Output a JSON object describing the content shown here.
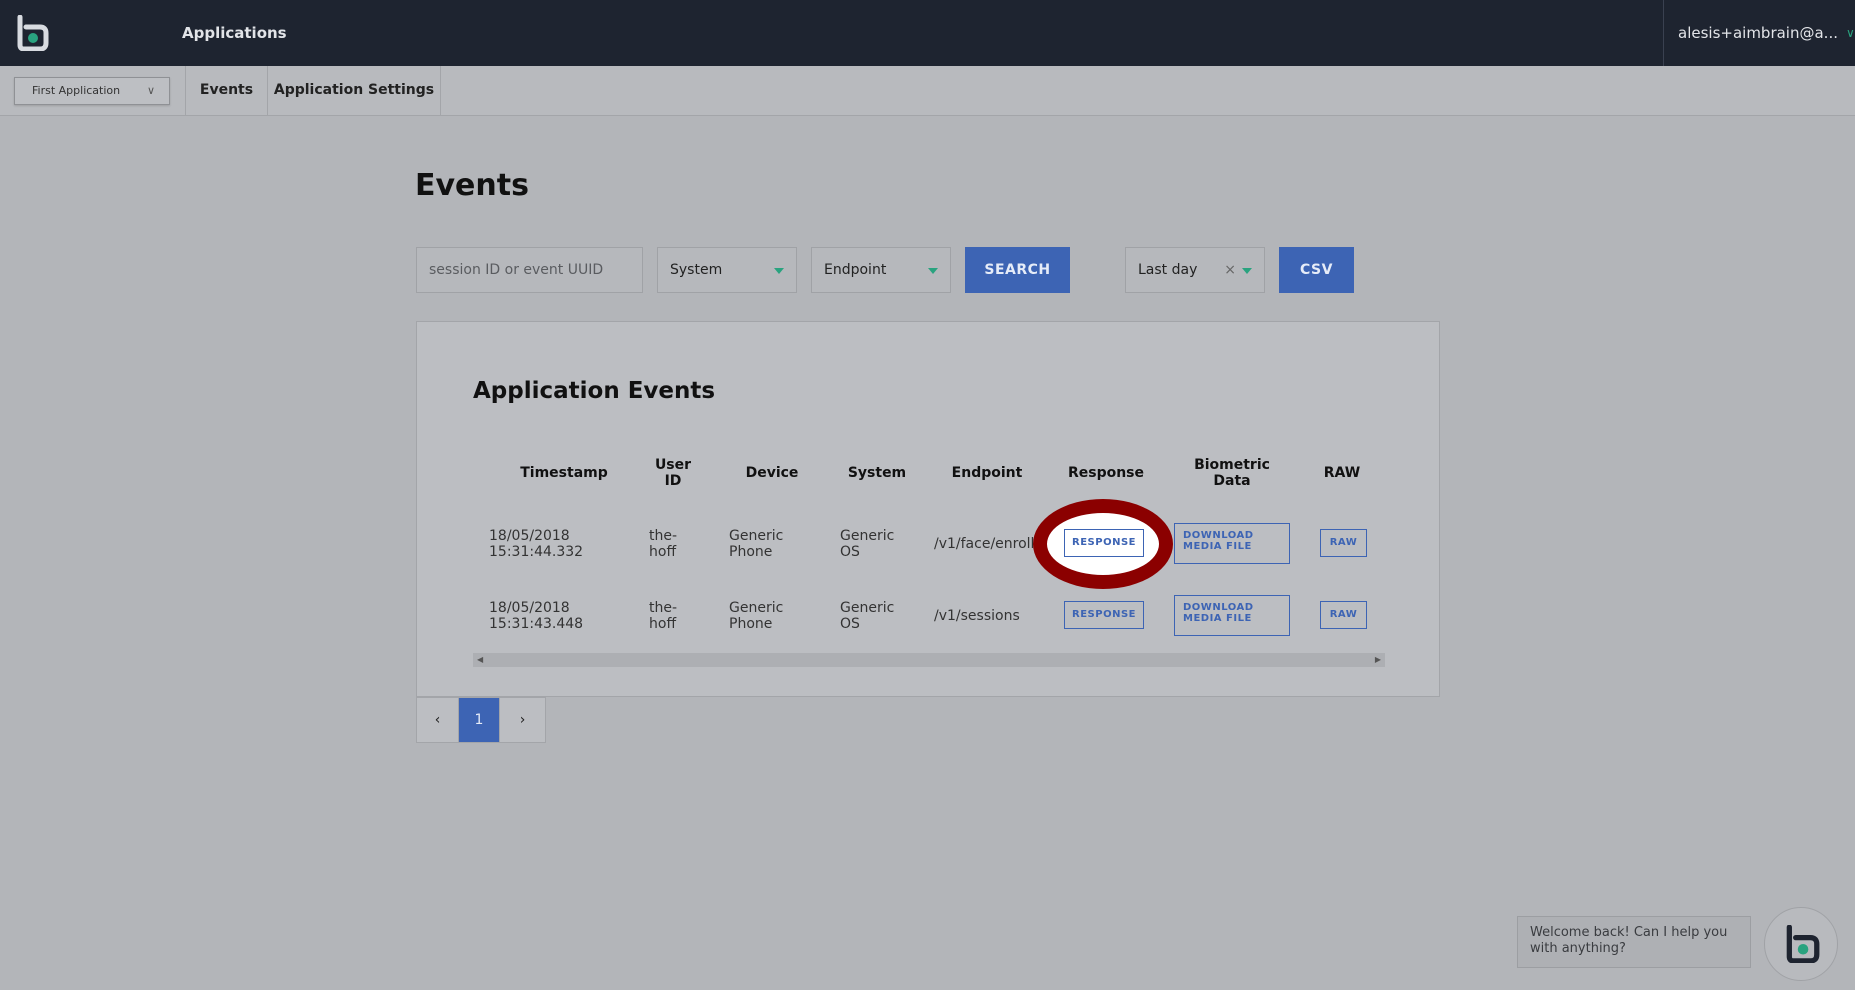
{
  "topbar": {
    "nav_label": "Applications",
    "user_email": "alesis+aimbrain@a..."
  },
  "subnav": {
    "app_selector": "First Application",
    "tabs": [
      {
        "label": "Events"
      },
      {
        "label": "Application Settings"
      }
    ]
  },
  "main": {
    "title": "Events",
    "search_placeholder": "session ID or event UUID",
    "system_select": "System",
    "endpoint_select": "Endpoint",
    "search_button": "SEARCH",
    "period_select": "Last day",
    "clear_symbol": "×",
    "csv_button": "CSV"
  },
  "events_table": {
    "title": "Application Events",
    "headers": {
      "timestamp": "Timestamp",
      "user_id_1": "User",
      "user_id_2": "ID",
      "device": "Device",
      "system": "System",
      "endpoint": "Endpoint",
      "response": "Response",
      "biometric_1": "Biometric",
      "biometric_2": "Data",
      "raw": "RAW"
    },
    "rows": [
      {
        "date": "18/05/2018",
        "time": "15:31:44.332",
        "user_1": "the-",
        "user_2": "hoff",
        "device_1": "Generic",
        "device_2": "Phone",
        "system_1": "Generic",
        "system_2": "OS",
        "endpoint": "/v1/face/enroll",
        "response_button": "RESPONSE",
        "download_1": "DOWNLOAD",
        "download_2": "MEDIA FILE",
        "raw_button": "RAW"
      },
      {
        "date": "18/05/2018",
        "time": "15:31:43.448",
        "user_1": "the-",
        "user_2": "hoff",
        "device_1": "Generic",
        "device_2": "Phone",
        "system_1": "Generic",
        "system_2": "OS",
        "endpoint": "/v1/sessions",
        "response_button": "RESPONSE",
        "download_1": "DOWNLOAD",
        "download_2": "MEDIA FILE",
        "raw_button": "RAW"
      }
    ]
  },
  "pagination": {
    "current_page": "1"
  },
  "chat": {
    "message": "Welcome back! Can I help you with anything?"
  },
  "colors": {
    "topbar": "#1e2430",
    "accent_green": "#29a37f",
    "primary_blue": "#3d64b4",
    "highlight_ring": "#8b0000"
  }
}
